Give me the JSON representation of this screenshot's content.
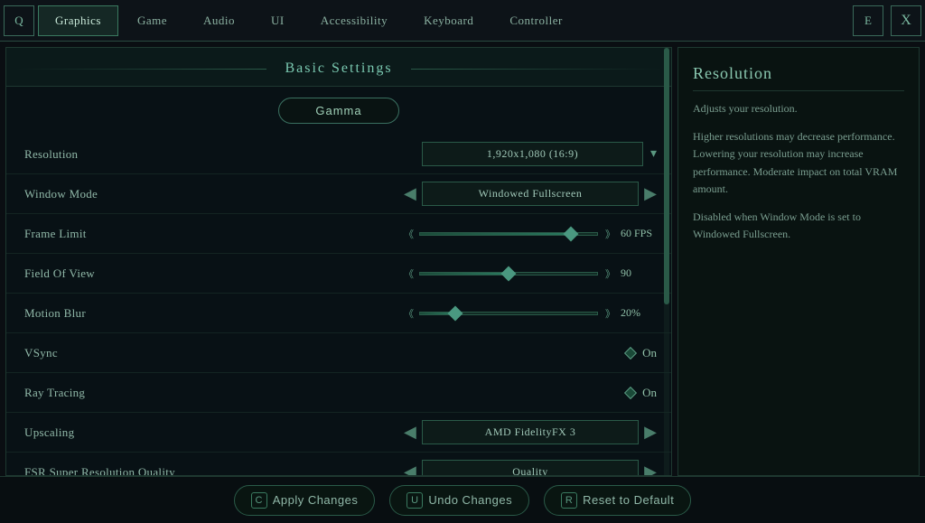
{
  "nav": {
    "left_icon": "Q",
    "right_icon": "E",
    "close": "X",
    "tabs": [
      {
        "label": "Graphics",
        "active": true
      },
      {
        "label": "Game",
        "active": false
      },
      {
        "label": "Audio",
        "active": false
      },
      {
        "label": "UI",
        "active": false
      },
      {
        "label": "Accessibility",
        "active": false
      },
      {
        "label": "Keyboard",
        "active": false
      },
      {
        "label": "Controller",
        "active": false
      }
    ]
  },
  "main": {
    "panel_title": "Basic Settings",
    "gamma_btn": "Gamma",
    "settings": [
      {
        "label": "Resolution",
        "type": "dropdown",
        "value": "1,920x1,080 (16:9)"
      },
      {
        "label": "Window Mode",
        "type": "selector",
        "value": "Windowed Fullscreen"
      },
      {
        "label": "Frame Limit",
        "type": "slider",
        "value": "60 FPS",
        "fill_pct": 85
      },
      {
        "label": "Field Of View",
        "type": "slider",
        "value": "90",
        "fill_pct": 50
      },
      {
        "label": "Motion Blur",
        "type": "slider",
        "value": "20%",
        "fill_pct": 20
      },
      {
        "label": "VSync",
        "type": "toggle",
        "value": "On"
      },
      {
        "label": "Ray Tracing",
        "type": "toggle",
        "value": "On"
      },
      {
        "label": "Upscaling",
        "type": "selector",
        "value": "AMD FidelityFX 3"
      },
      {
        "label": "FSR Super Resolution Quality",
        "type": "selector",
        "value": "Quality"
      }
    ]
  },
  "info_panel": {
    "title": "Resolution",
    "description_1": "Adjusts your resolution.",
    "description_2": "Higher resolutions may decrease performance. Lowering your resolution may increase performance. Moderate impact on total VRAM amount.",
    "description_3": "Disabled when Window Mode is set to Windowed Fullscreen."
  },
  "bottom_bar": {
    "apply_key": "C",
    "apply_label": "Apply Changes",
    "undo_key": "U",
    "undo_label": "Undo Changes",
    "reset_key": "R",
    "reset_label": "Reset to Default"
  }
}
